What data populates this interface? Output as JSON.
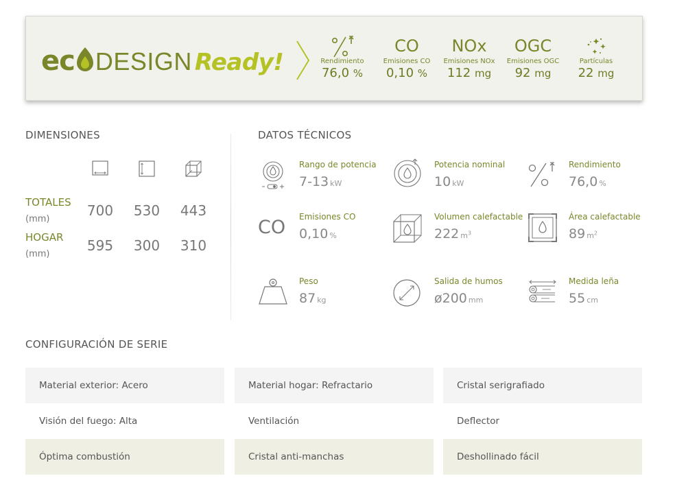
{
  "eco_banner": {
    "logo": {
      "eco": "ec",
      "eco_tail": "",
      "design": "DESIGN",
      "ready": "Ready!"
    },
    "metrics": [
      {
        "symbol": "%",
        "label": "Rendimiento",
        "value": "76,0",
        "unit": "%"
      },
      {
        "symbol": "CO",
        "label": "Emisiones CO",
        "value": "0,10",
        "unit": "%"
      },
      {
        "symbol": "NOx",
        "label": "Emisiones NOx",
        "value": "112",
        "unit": "mg"
      },
      {
        "symbol": "OGC",
        "label": "Emisiones OGC",
        "value": "92",
        "unit": "mg"
      },
      {
        "symbol": "particles-icon",
        "label": "Partículas",
        "value": "22",
        "unit": "mg"
      }
    ]
  },
  "dimensions": {
    "title": "DIMENSIONES",
    "icons": [
      "width-icon",
      "height-icon",
      "depth-icon"
    ],
    "rows": [
      {
        "label": "TOTALES",
        "unit": "(mm)",
        "values": [
          "700",
          "530",
          "443"
        ]
      },
      {
        "label": "HOGAR",
        "unit": "(mm)",
        "values": [
          "595",
          "300",
          "310"
        ]
      }
    ]
  },
  "technical": {
    "title": "DATOS TÉCNICOS",
    "items": [
      {
        "icon": "power-range-icon",
        "label": "Rango de potencia",
        "value": "7-13",
        "unit": "kW"
      },
      {
        "icon": "nominal-power-icon",
        "label": "Potencia nominal",
        "value": "10",
        "unit": "kW"
      },
      {
        "icon": "efficiency-icon",
        "label": "Rendimiento",
        "value": "76,0",
        "unit": "%"
      },
      {
        "icon": "co-icon",
        "symbol": "CO",
        "label": "Emisiones CO",
        "value": "0,10",
        "unit": "%"
      },
      {
        "icon": "heated-volume-icon",
        "label": "Volumen calefactable",
        "value": "222",
        "unit": "m",
        "sup": "3"
      },
      {
        "icon": "heated-area-icon",
        "label": "Área calefactable",
        "value": "89",
        "unit": "m",
        "sup": "2"
      },
      {
        "icon": "weight-icon",
        "label": "Peso",
        "value": "87",
        "unit": "kg"
      },
      {
        "icon": "flue-outlet-icon",
        "label": "Salida de humos",
        "value": "ø200",
        "unit": "mm"
      },
      {
        "icon": "log-size-icon",
        "label": "Medida leña",
        "value": "55",
        "unit": "cm"
      }
    ]
  },
  "configuration": {
    "title": "CONFIGURACIÓN DE SERIE",
    "rows": [
      [
        "Material exterior: Acero",
        "Material hogar: Refractario",
        "Cristal serigrafiado"
      ],
      [
        "Visión del fuego: Alta",
        "Ventilación",
        "Deflector"
      ],
      [
        "Óptima combustión",
        "Cristal anti-manchas",
        "Deshollinado fácil"
      ]
    ]
  },
  "colors": {
    "accent_olive": "#7a8629",
    "accent_lime": "#b5c226",
    "row_light": "#f4f4f4",
    "row_green": "#efefe4"
  }
}
